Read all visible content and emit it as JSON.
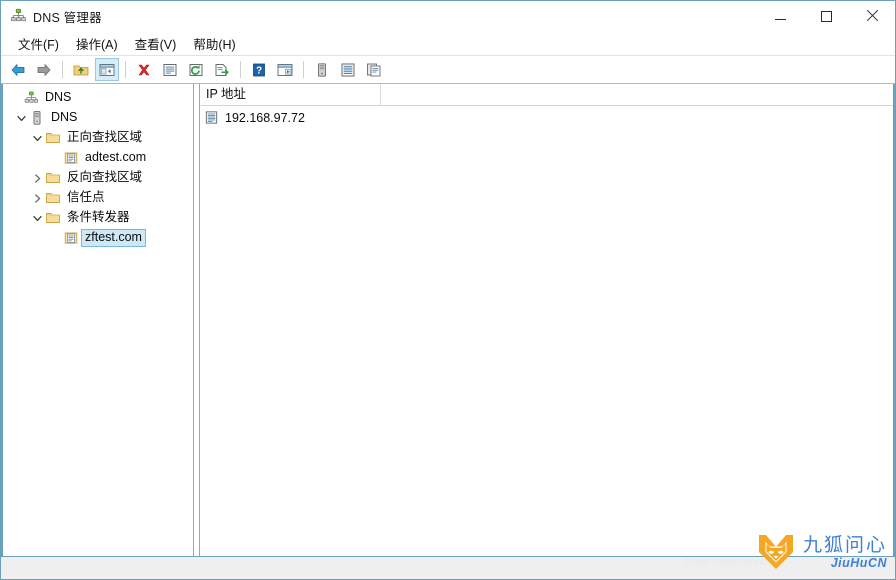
{
  "window": {
    "title": "DNS 管理器",
    "icon": "dns-console-icon",
    "controls": {
      "minimize": "最小化",
      "maximize": "最大化",
      "close": "关闭"
    }
  },
  "menubar": {
    "items": [
      {
        "label": "文件(F)",
        "name": "menu-file"
      },
      {
        "label": "操作(A)",
        "name": "menu-action"
      },
      {
        "label": "查看(V)",
        "name": "menu-view"
      },
      {
        "label": "帮助(H)",
        "name": "menu-help"
      }
    ]
  },
  "toolbar": {
    "items": [
      {
        "name": "back-icon",
        "title": "后退"
      },
      {
        "name": "forward-icon",
        "title": "前进"
      },
      {
        "name": "up-one-level-icon",
        "title": "向上一级"
      },
      {
        "name": "show-hide-tree-icon",
        "title": "显示/隐藏控制台树",
        "active": true
      },
      {
        "name": "delete-icon",
        "title": "删除"
      },
      {
        "name": "properties-icon",
        "title": "属性"
      },
      {
        "name": "refresh-icon",
        "title": "刷新"
      },
      {
        "name": "export-list-icon",
        "title": "导出列表"
      },
      {
        "name": "help-icon",
        "title": "帮助"
      },
      {
        "name": "run-console-icon",
        "title": "运行"
      },
      {
        "name": "server-icon",
        "title": "服务器"
      },
      {
        "name": "list-view-icon",
        "title": "列表"
      },
      {
        "name": "copy-icon",
        "title": "复制"
      }
    ]
  },
  "tree": {
    "nodes": [
      {
        "label": "DNS",
        "icon": "dns-console-icon",
        "indent": 0,
        "chevron": "none",
        "selected": false,
        "name": "tree-node-dns-root"
      },
      {
        "label": "DNS",
        "icon": "server-icon",
        "indent": 1,
        "chevron": "expanded",
        "selected": false,
        "name": "tree-node-dns-server"
      },
      {
        "label": "正向查找区域",
        "icon": "folder-icon",
        "indent": 2,
        "chevron": "expanded",
        "selected": false,
        "name": "tree-node-forward-lookup-zones"
      },
      {
        "label": "adtest.com",
        "icon": "zone-icon",
        "indent": 3,
        "chevron": "none",
        "selected": false,
        "name": "tree-node-adtest-com"
      },
      {
        "label": "反向查找区域",
        "icon": "folder-icon",
        "indent": 2,
        "chevron": "collapsed",
        "selected": false,
        "name": "tree-node-reverse-lookup-zones"
      },
      {
        "label": "信任点",
        "icon": "folder-icon",
        "indent": 2,
        "chevron": "collapsed",
        "selected": false,
        "name": "tree-node-trust-points"
      },
      {
        "label": "条件转发器",
        "icon": "folder-icon",
        "indent": 2,
        "chevron": "expanded",
        "selected": false,
        "name": "tree-node-conditional-forwarders"
      },
      {
        "label": "zftest.com",
        "icon": "zone-icon",
        "indent": 3,
        "chevron": "none",
        "selected": true,
        "name": "tree-node-zftest-com"
      }
    ]
  },
  "list": {
    "columns": [
      {
        "label": "IP 地址",
        "name": "column-ip-address"
      },
      {
        "label": "",
        "name": "column-secondary"
      }
    ],
    "rows": [
      {
        "icon": "record-list-icon",
        "cells": [
          "192.168.97.72"
        ],
        "name": "list-row-ip"
      }
    ]
  },
  "statusbar": {
    "text": ""
  },
  "watermark": {
    "logo": "fox-head-logo",
    "cn_text": "九狐问心",
    "en_text": "JiuHuCN",
    "url_text": "https://www.jiuhu...",
    "accent": "#3f7fd6",
    "logo_color": "#f5a623"
  },
  "colors": {
    "window_border": "#6ca0b8",
    "selection": "#cde8f6",
    "selection_border": "#7cb8da",
    "folder": "#f3d07a",
    "statusbar": "#efefef"
  }
}
